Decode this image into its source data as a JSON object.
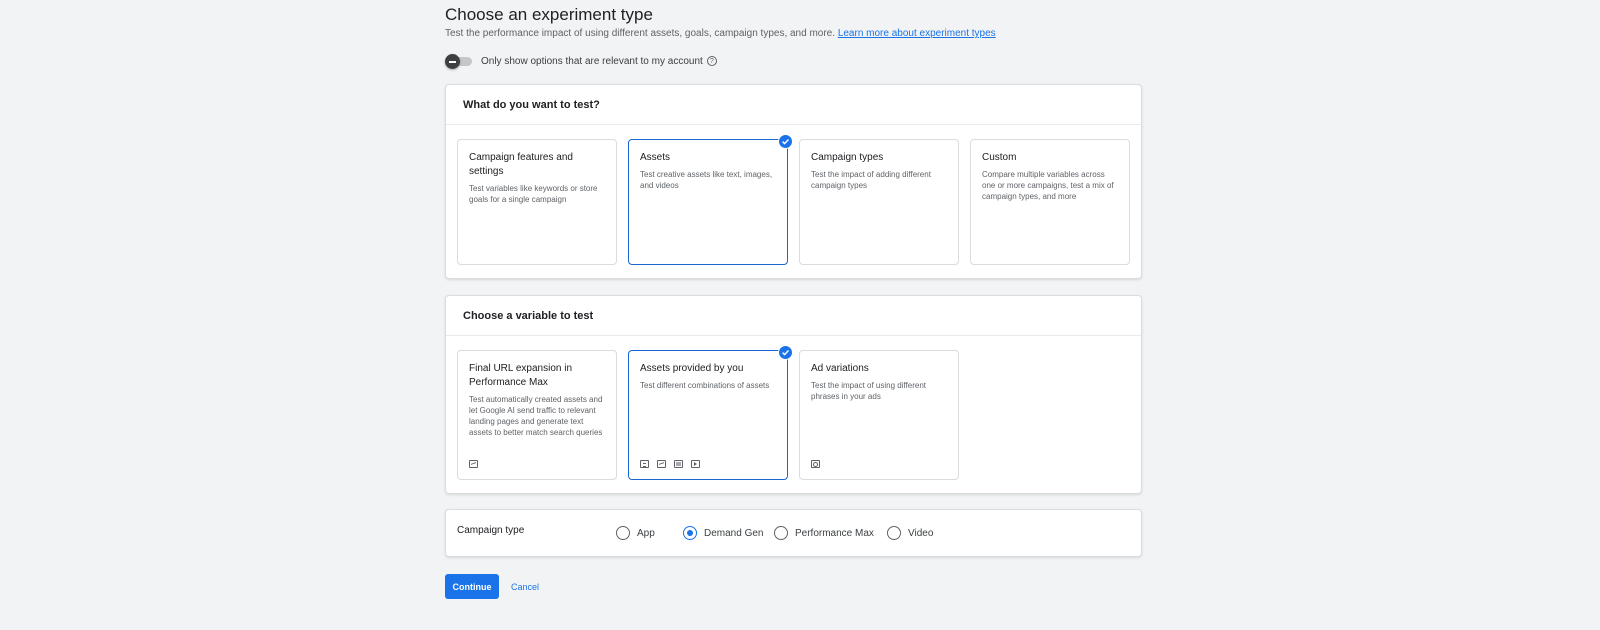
{
  "header": {
    "title": "Choose an experiment type",
    "subtitle": "Test the performance impact of using different assets, goals, campaign types, and more.",
    "learn_more": "Learn more about experiment types"
  },
  "toggle": {
    "label": "Only show options that are relevant to my account",
    "state": "off",
    "help_icon": "help-circle-icon"
  },
  "what_to_test": {
    "heading": "What do you want to test?",
    "cards": [
      {
        "title": "Campaign features and settings",
        "description": "Test variables like keywords or store goals for a single campaign",
        "selected": false
      },
      {
        "title": "Assets",
        "description": "Test creative assets like text, images, and videos",
        "selected": true
      },
      {
        "title": "Campaign types",
        "description": "Test the impact of adding different campaign types",
        "selected": false
      },
      {
        "title": "Custom",
        "description": "Compare multiple variables across one or more campaigns, test a mix of campaign types, and more",
        "selected": false
      }
    ]
  },
  "variable": {
    "heading": "Choose a variable to test",
    "cards": [
      {
        "title": "Final URL expansion in Performance Max",
        "description": "Test automatically created assets and let Google AI send traffic to relevant landing pages and generate text assets to better match search queries",
        "selected": false,
        "icons": [
          "performance-max-icon"
        ]
      },
      {
        "title": "Assets provided by you",
        "description": "Test different combinations of assets",
        "selected": true,
        "icons": [
          "text-asset-icon",
          "image-asset-icon",
          "display-asset-icon",
          "video-asset-icon"
        ]
      },
      {
        "title": "Ad variations",
        "description": "Test the impact of using different phrases in your ads",
        "selected": false,
        "icons": [
          "search-asset-icon"
        ]
      }
    ]
  },
  "campaign_type": {
    "label": "Campaign type",
    "options": [
      "App",
      "Demand Gen",
      "Performance Max",
      "Video"
    ],
    "selected": "Demand Gen"
  },
  "actions": {
    "continue": "Continue",
    "cancel": "Cancel"
  },
  "colors": {
    "accent": "#1a73e8",
    "background": "#f1f3f4"
  }
}
